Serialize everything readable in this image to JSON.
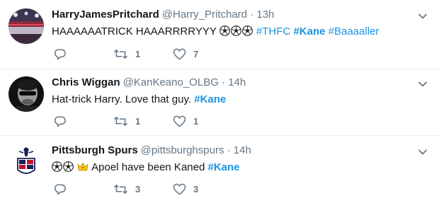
{
  "tweets": [
    {
      "name": "HarryJamesPritchard",
      "handle": "@Harry_Pritchard",
      "separator": "·",
      "time": "13h",
      "text_before": "HAAAAAATRICK HAAARRRRYYY",
      "hashtags": [
        "#THFC",
        "#Kane",
        "#Baaaaller"
      ],
      "retweets": "1",
      "likes": "7",
      "avatar": "stadium-photo"
    },
    {
      "name": "Chris Wiggan",
      "handle": "@KanKeano_OLBG",
      "separator": "·",
      "time": "14h",
      "text_before": "Hat-trick Harry. Love that guy.",
      "hashtags": [
        "#Kane"
      ],
      "retweets": "1",
      "likes": "1",
      "avatar": "bw-portrait"
    },
    {
      "name": "Pittsburgh Spurs",
      "handle": "@pittsburghspurs",
      "separator": "·",
      "time": "14h",
      "text_before": "Apoel have been Kaned",
      "hashtags": [
        "#Kane"
      ],
      "retweets": "3",
      "likes": "3",
      "avatar": "spurs-crest"
    }
  ],
  "colors": {
    "link": "#1b95e0",
    "muted": "#657786",
    "text": "#14171a",
    "divider": "#e6ecf0"
  },
  "icons": {
    "reply": "reply-icon",
    "retweet": "retweet-icon",
    "like": "heart-icon",
    "more": "chevron-down-icon",
    "emoji_ball": "soccer-ball-icon",
    "emoji_crown": "crown-icon"
  }
}
